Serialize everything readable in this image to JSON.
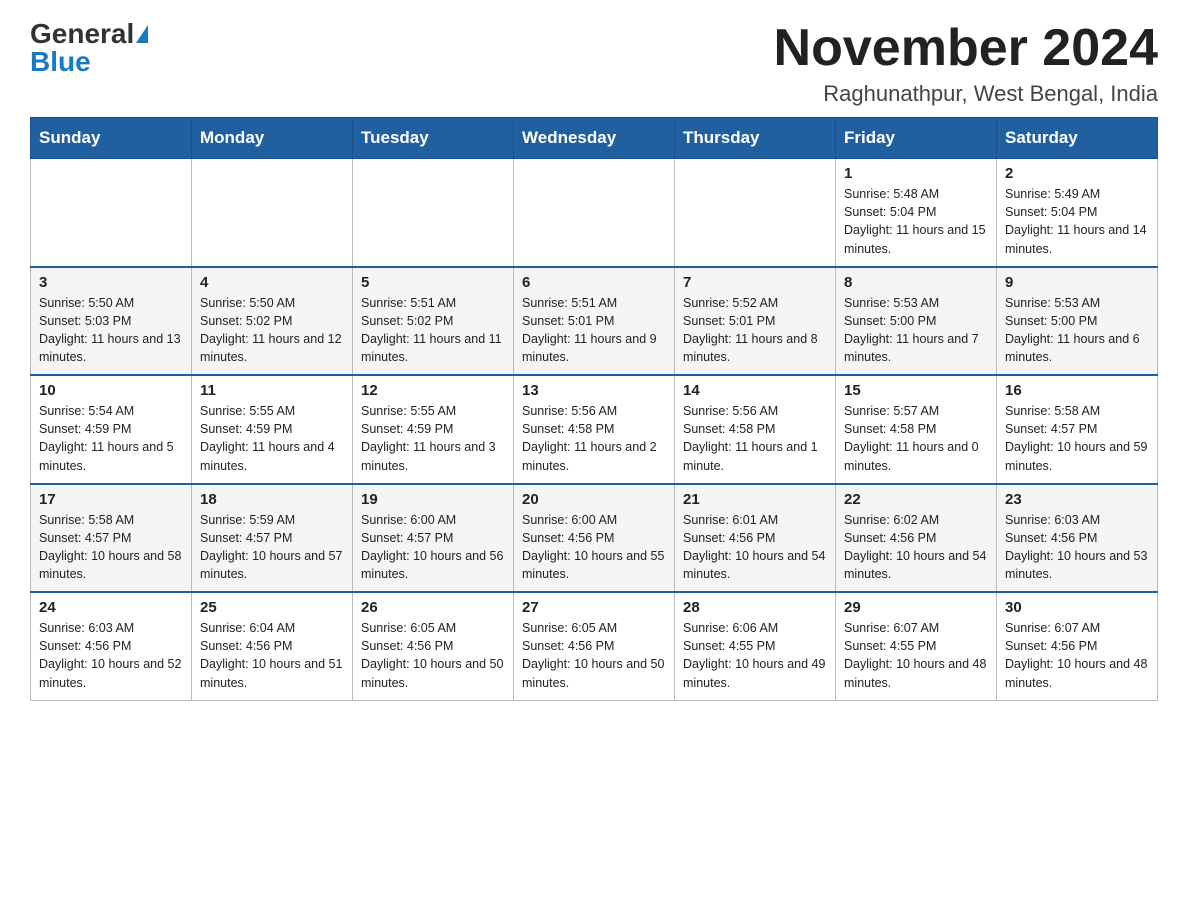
{
  "logo": {
    "general": "General",
    "blue": "Blue"
  },
  "header": {
    "title": "November 2024",
    "subtitle": "Raghunathpur, West Bengal, India"
  },
  "weekdays": [
    "Sunday",
    "Monday",
    "Tuesday",
    "Wednesday",
    "Thursday",
    "Friday",
    "Saturday"
  ],
  "weeks": [
    [
      {
        "day": "",
        "info": ""
      },
      {
        "day": "",
        "info": ""
      },
      {
        "day": "",
        "info": ""
      },
      {
        "day": "",
        "info": ""
      },
      {
        "day": "",
        "info": ""
      },
      {
        "day": "1",
        "info": "Sunrise: 5:48 AM\nSunset: 5:04 PM\nDaylight: 11 hours and 15 minutes."
      },
      {
        "day": "2",
        "info": "Sunrise: 5:49 AM\nSunset: 5:04 PM\nDaylight: 11 hours and 14 minutes."
      }
    ],
    [
      {
        "day": "3",
        "info": "Sunrise: 5:50 AM\nSunset: 5:03 PM\nDaylight: 11 hours and 13 minutes."
      },
      {
        "day": "4",
        "info": "Sunrise: 5:50 AM\nSunset: 5:02 PM\nDaylight: 11 hours and 12 minutes."
      },
      {
        "day": "5",
        "info": "Sunrise: 5:51 AM\nSunset: 5:02 PM\nDaylight: 11 hours and 11 minutes."
      },
      {
        "day": "6",
        "info": "Sunrise: 5:51 AM\nSunset: 5:01 PM\nDaylight: 11 hours and 9 minutes."
      },
      {
        "day": "7",
        "info": "Sunrise: 5:52 AM\nSunset: 5:01 PM\nDaylight: 11 hours and 8 minutes."
      },
      {
        "day": "8",
        "info": "Sunrise: 5:53 AM\nSunset: 5:00 PM\nDaylight: 11 hours and 7 minutes."
      },
      {
        "day": "9",
        "info": "Sunrise: 5:53 AM\nSunset: 5:00 PM\nDaylight: 11 hours and 6 minutes."
      }
    ],
    [
      {
        "day": "10",
        "info": "Sunrise: 5:54 AM\nSunset: 4:59 PM\nDaylight: 11 hours and 5 minutes."
      },
      {
        "day": "11",
        "info": "Sunrise: 5:55 AM\nSunset: 4:59 PM\nDaylight: 11 hours and 4 minutes."
      },
      {
        "day": "12",
        "info": "Sunrise: 5:55 AM\nSunset: 4:59 PM\nDaylight: 11 hours and 3 minutes."
      },
      {
        "day": "13",
        "info": "Sunrise: 5:56 AM\nSunset: 4:58 PM\nDaylight: 11 hours and 2 minutes."
      },
      {
        "day": "14",
        "info": "Sunrise: 5:56 AM\nSunset: 4:58 PM\nDaylight: 11 hours and 1 minute."
      },
      {
        "day": "15",
        "info": "Sunrise: 5:57 AM\nSunset: 4:58 PM\nDaylight: 11 hours and 0 minutes."
      },
      {
        "day": "16",
        "info": "Sunrise: 5:58 AM\nSunset: 4:57 PM\nDaylight: 10 hours and 59 minutes."
      }
    ],
    [
      {
        "day": "17",
        "info": "Sunrise: 5:58 AM\nSunset: 4:57 PM\nDaylight: 10 hours and 58 minutes."
      },
      {
        "day": "18",
        "info": "Sunrise: 5:59 AM\nSunset: 4:57 PM\nDaylight: 10 hours and 57 minutes."
      },
      {
        "day": "19",
        "info": "Sunrise: 6:00 AM\nSunset: 4:57 PM\nDaylight: 10 hours and 56 minutes."
      },
      {
        "day": "20",
        "info": "Sunrise: 6:00 AM\nSunset: 4:56 PM\nDaylight: 10 hours and 55 minutes."
      },
      {
        "day": "21",
        "info": "Sunrise: 6:01 AM\nSunset: 4:56 PM\nDaylight: 10 hours and 54 minutes."
      },
      {
        "day": "22",
        "info": "Sunrise: 6:02 AM\nSunset: 4:56 PM\nDaylight: 10 hours and 54 minutes."
      },
      {
        "day": "23",
        "info": "Sunrise: 6:03 AM\nSunset: 4:56 PM\nDaylight: 10 hours and 53 minutes."
      }
    ],
    [
      {
        "day": "24",
        "info": "Sunrise: 6:03 AM\nSunset: 4:56 PM\nDaylight: 10 hours and 52 minutes."
      },
      {
        "day": "25",
        "info": "Sunrise: 6:04 AM\nSunset: 4:56 PM\nDaylight: 10 hours and 51 minutes."
      },
      {
        "day": "26",
        "info": "Sunrise: 6:05 AM\nSunset: 4:56 PM\nDaylight: 10 hours and 50 minutes."
      },
      {
        "day": "27",
        "info": "Sunrise: 6:05 AM\nSunset: 4:56 PM\nDaylight: 10 hours and 50 minutes."
      },
      {
        "day": "28",
        "info": "Sunrise: 6:06 AM\nSunset: 4:55 PM\nDaylight: 10 hours and 49 minutes."
      },
      {
        "day": "29",
        "info": "Sunrise: 6:07 AM\nSunset: 4:55 PM\nDaylight: 10 hours and 48 minutes."
      },
      {
        "day": "30",
        "info": "Sunrise: 6:07 AM\nSunset: 4:56 PM\nDaylight: 10 hours and 48 minutes."
      }
    ]
  ]
}
